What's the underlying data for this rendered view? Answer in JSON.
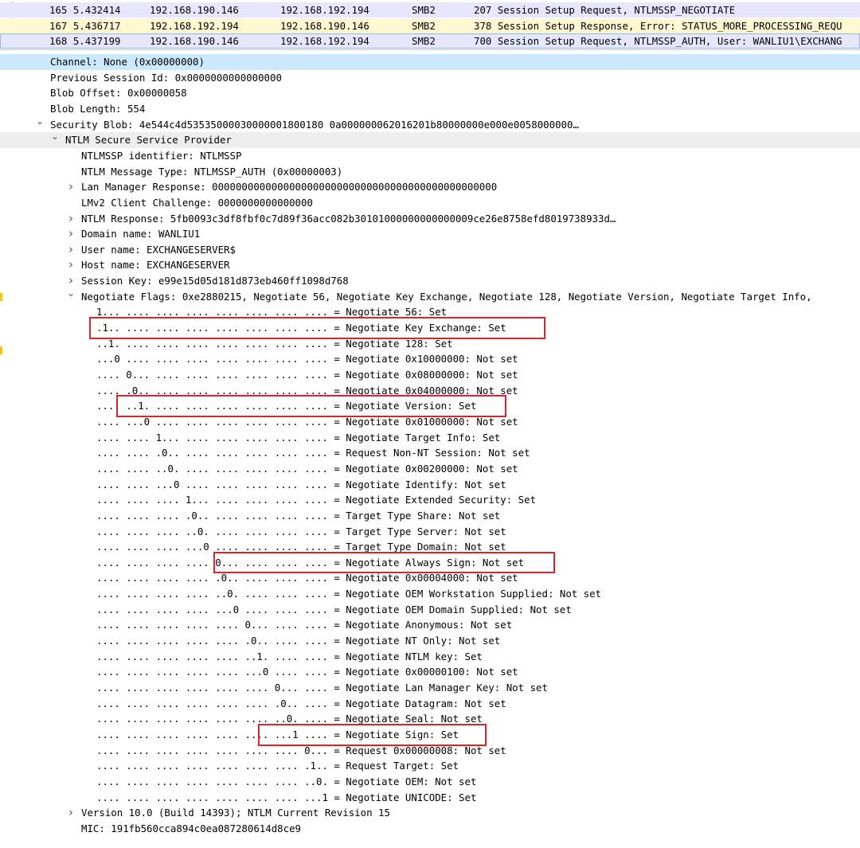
{
  "packets": [
    {
      "no": "165 5.432414",
      "src": "192.168.190.146",
      "dst": "192.168.192.194",
      "proto": "SMB2",
      "info": "207 Session Setup Request, NTLMSSP_NEGOTIATE"
    },
    {
      "no": "167 5.436717",
      "src": "192.168.192.194",
      "dst": "192.168.190.146",
      "proto": "SMB2",
      "info": "378 Session Setup Response, Error: STATUS_MORE_PROCESSING_REQU"
    },
    {
      "no": "168 5.437199",
      "src": "192.168.190.146",
      "dst": "192.168.192.194",
      "proto": "SMB2",
      "info": "700 Session Setup Request, NTLMSSP_AUTH, User: WANLIU1\\EXCHANG"
    }
  ],
  "details": [
    {
      "text": "Channel: None (0x00000000)"
    },
    {
      "text": "Previous Session Id: 0x0000000000000000"
    },
    {
      "text": "Blob Offset: 0x00000058"
    },
    {
      "text": "Blob Length: 554"
    },
    {
      "text": "Security Blob: 4e544c4d53535000030000001800180 0a000000062016201b80000000e000e0058000000…"
    },
    {
      "text": "NTLM Secure Service Provider"
    },
    {
      "text": "NTLMSSP identifier: NTLMSSP"
    },
    {
      "text": "NTLM Message Type: NTLMSSP_AUTH (0x00000003)"
    },
    {
      "text": "Lan Manager Response: 000000000000000000000000000000000000000000000000"
    },
    {
      "text": "LMv2 Client Challenge: 0000000000000000"
    },
    {
      "text": "NTLM Response: 5fb0093c3df8fbf0c7d89f36acc082b30101000000000000009ce26e8758efd8019738933d…"
    },
    {
      "text": "Domain name: WANLIU1"
    },
    {
      "text": "User name: EXCHANGESERVER$"
    },
    {
      "text": "Host name: EXCHANGESERVER"
    },
    {
      "text": "Session Key: e99e15d05d181d873eb460ff1098d768"
    },
    {
      "text": "Negotiate Flags: 0xe2880215, Negotiate 56, Negotiate Key Exchange, Negotiate 128, Negotiate Version, Negotiate Target Info,"
    },
    {
      "text": "1... .... .... .... .... .... .... .... = Negotiate 56: Set"
    },
    {
      "text": ".1.. .... .... .... .... .... .... .... = Negotiate Key Exchange: Set"
    },
    {
      "text": "..1. .... .... .... .... .... .... .... = Negotiate 128: Set"
    },
    {
      "text": "...0 .... .... .... .... .... .... .... = Negotiate 0x10000000: Not set"
    },
    {
      "text": ".... 0... .... .... .... .... .... .... = Negotiate 0x08000000: Not set"
    },
    {
      "text": ".... .0.. .... .... .... .... .... .... = Negotiate 0x04000000: Not set"
    },
    {
      "text": ".... ..1. .... .... .... .... .... .... = Negotiate Version: Set"
    },
    {
      "text": ".... ...0 .... .... .... .... .... .... = Negotiate 0x01000000: Not set"
    },
    {
      "text": ".... .... 1... .... .... .... .... .... = Negotiate Target Info: Set"
    },
    {
      "text": ".... .... .0.. .... .... .... .... .... = Request Non-NT Session: Not set"
    },
    {
      "text": ".... .... ..0. .... .... .... .... .... = Negotiate 0x00200000: Not set"
    },
    {
      "text": ".... .... ...0 .... .... .... .... .... = Negotiate Identify: Not set"
    },
    {
      "text": ".... .... .... 1... .... .... .... .... = Negotiate Extended Security: Set"
    },
    {
      "text": ".... .... .... .0.. .... .... .... .... = Target Type Share: Not set"
    },
    {
      "text": ".... .... .... ..0. .... .... .... .... = Target Type Server: Not set"
    },
    {
      "text": ".... .... .... ...0 .... .... .... .... = Target Type Domain: Not set"
    },
    {
      "text": ".... .... .... .... 0... .... .... .... = Negotiate Always Sign: Not set"
    },
    {
      "text": ".... .... .... .... .0.. .... .... .... = Negotiate 0x00004000: Not set"
    },
    {
      "text": ".... .... .... .... ..0. .... .... .... = Negotiate OEM Workstation Supplied: Not set"
    },
    {
      "text": ".... .... .... .... ...0 .... .... .... = Negotiate OEM Domain Supplied: Not set"
    },
    {
      "text": ".... .... .... .... .... 0... .... .... = Negotiate Anonymous: Not set"
    },
    {
      "text": ".... .... .... .... .... .0.. .... .... = Negotiate NT Only: Not set"
    },
    {
      "text": ".... .... .... .... .... ..1. .... .... = Negotiate NTLM key: Set"
    },
    {
      "text": ".... .... .... .... .... ...0 .... .... = Negotiate 0x00000100: Not set"
    },
    {
      "text": ".... .... .... .... .... .... 0... .... = Negotiate Lan Manager Key: Not set"
    },
    {
      "text": ".... .... .... .... .... .... .0.. .... = Negotiate Datagram: Not set"
    },
    {
      "text": ".... .... .... .... .... .... ..0. .... = Negotiate Seal: Not set"
    },
    {
      "text": ".... .... .... .... .... .... ...1 .... = Negotiate Sign: Set"
    },
    {
      "text": ".... .... .... .... .... .... .... 0... = Request 0x00000008: Not set"
    },
    {
      "text": ".... .... .... .... .... .... .... .1.. = Request Target: Set"
    },
    {
      "text": ".... .... .... .... .... .... .... ..0. = Negotiate OEM: Not set"
    },
    {
      "text": ".... .... .... .... .... .... .... ...1 = Negotiate UNICODE: Set"
    },
    {
      "text": "Version 10.0 (Build 14393); NTLM Current Revision 15"
    },
    {
      "text": "MIC: 191fb560cca894c0ea087280614d8ce9"
    }
  ],
  "icons": {
    "expanded": "chevron-down-icon",
    "collapsed": "chevron-right-icon"
  },
  "colors": {
    "packet_row_blue": "#e7e6ff",
    "packet_row_yellow": "#fdf8cf",
    "selected_row": "#cce8ff",
    "highlight_box": "#d9242b"
  }
}
